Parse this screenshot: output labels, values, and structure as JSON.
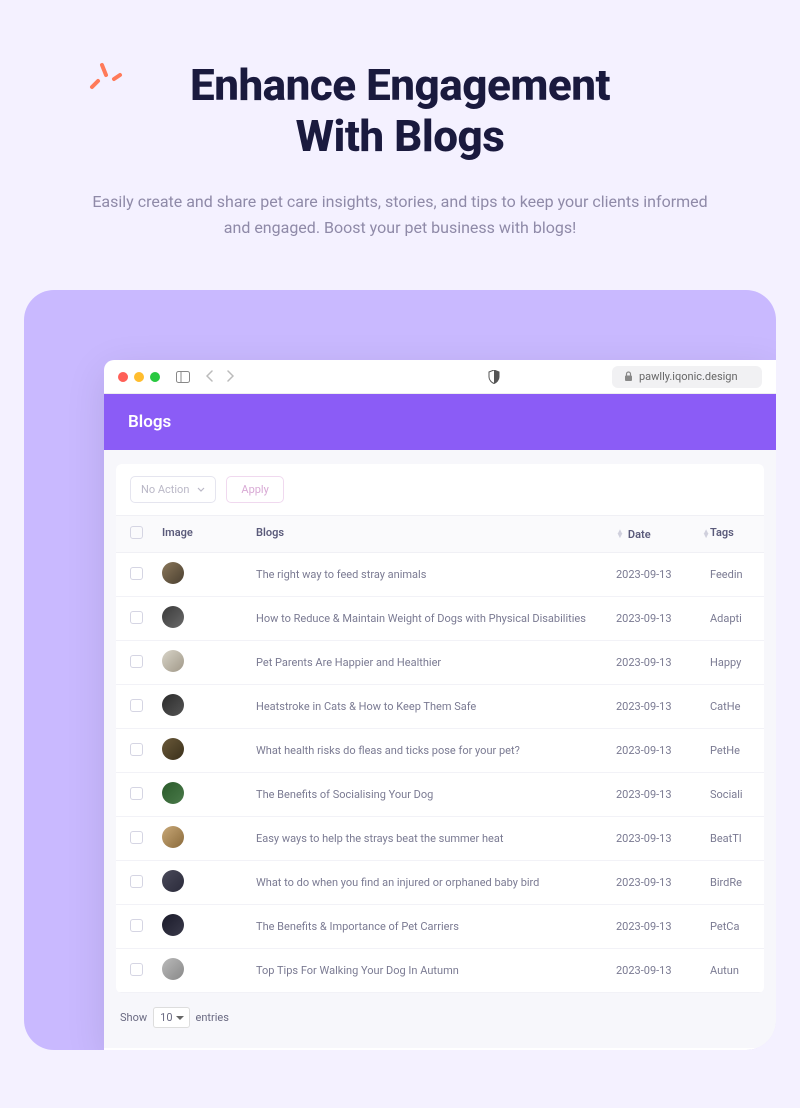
{
  "hero": {
    "title_line1": "Enhance Engagement",
    "title_line2": "With Blogs",
    "subtitle": "Easily create and share pet care insights, stories, and tips to keep your clients informed and engaged. Boost your pet business with blogs!"
  },
  "browser": {
    "url": "pawlly.iqonic.design"
  },
  "app": {
    "header_title": "Blogs",
    "toolbar": {
      "action_select": "No Action",
      "apply_label": "Apply"
    },
    "columns": {
      "image": "Image",
      "blogs": "Blogs",
      "date": "Date",
      "tags": "Tags"
    },
    "rows": [
      {
        "title": "The right way to feed stray animals",
        "date": "2023-09-13",
        "tag": "Feedin"
      },
      {
        "title": "How to Reduce & Maintain Weight of Dogs with Physical Disabilities",
        "date": "2023-09-13",
        "tag": "Adapti"
      },
      {
        "title": "Pet Parents Are Happier and Healthier",
        "date": "2023-09-13",
        "tag": "Happy"
      },
      {
        "title": "Heatstroke in Cats & How to Keep Them Safe",
        "date": "2023-09-13",
        "tag": "CatHe"
      },
      {
        "title": "What health risks do fleas and ticks pose for your pet?",
        "date": "2023-09-13",
        "tag": "PetHe"
      },
      {
        "title": "The Benefits of Socialising Your Dog",
        "date": "2023-09-13",
        "tag": "Sociali"
      },
      {
        "title": "Easy ways to help the strays beat the summer heat",
        "date": "2023-09-13",
        "tag": "BeatTl"
      },
      {
        "title": "What to do when you find an injured or orphaned baby bird",
        "date": "2023-09-13",
        "tag": "BirdRe"
      },
      {
        "title": "The Benefits & Importance of Pet Carriers",
        "date": "2023-09-13",
        "tag": "PetCa"
      },
      {
        "title": "Top Tips For Walking Your Dog In Autumn",
        "date": "2023-09-13",
        "tag": "Autun"
      }
    ],
    "pager": {
      "show": "Show",
      "per_page": "10",
      "entries": "entries"
    }
  }
}
